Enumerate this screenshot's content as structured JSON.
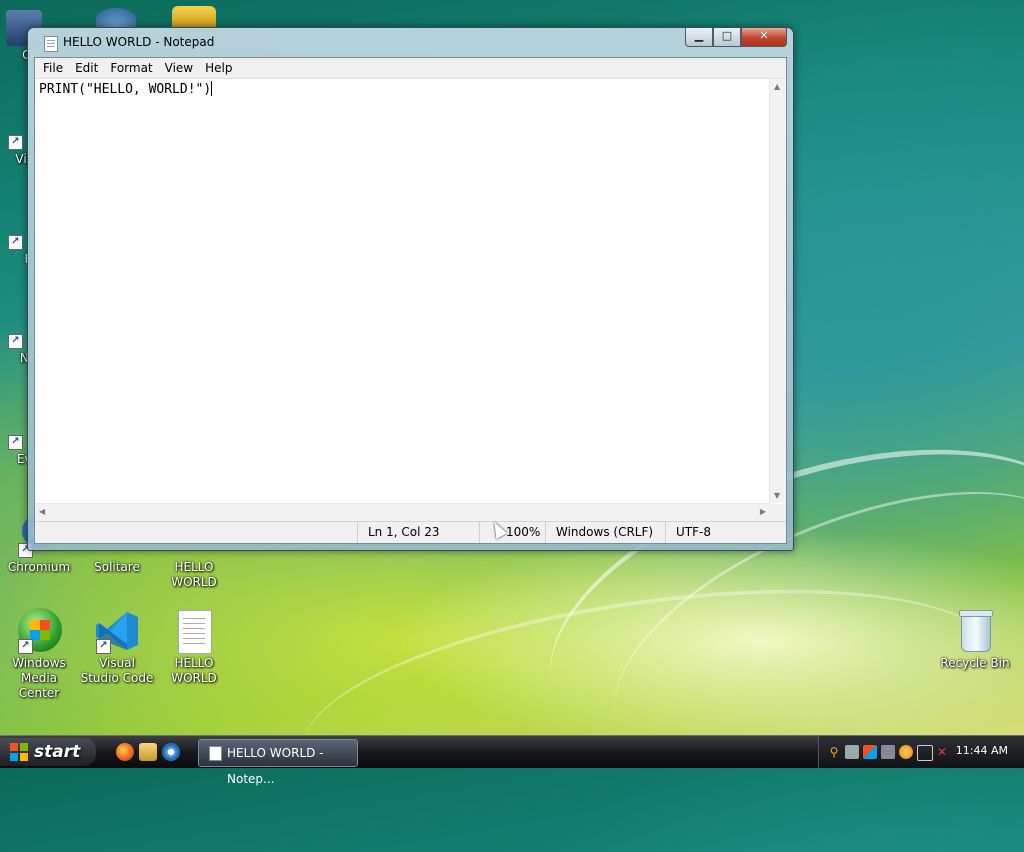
{
  "window": {
    "title": "HELLO WORLD - Notepad",
    "menu": [
      "File",
      "Edit",
      "Format",
      "View",
      "Help"
    ],
    "content": "PRINT(\"HELLO, WORLD!\")",
    "status": {
      "position": "Ln 1, Col 23",
      "zoom": "100%",
      "line_ending": "Windows (CRLF)",
      "encoding": "UTF-8"
    },
    "buttons": {
      "minimize": "▁",
      "maximize": "□",
      "close": "✕"
    }
  },
  "desktop": {
    "partial_labels": [
      "Co",
      "Visu",
      "F",
      "No",
      "Eve"
    ],
    "icons": [
      {
        "label": "Chromium"
      },
      {
        "label": "Solitare"
      },
      {
        "label": "HELLO WORLD"
      },
      {
        "label": "Windows Media Center"
      },
      {
        "label": "Visual Studio Code"
      },
      {
        "label": "HELLO WORLD"
      },
      {
        "label": "Recycle Bin"
      }
    ]
  },
  "taskbar": {
    "start_label": "start",
    "task": "HELLO WORLD - Notep...",
    "clock": "11:44 AM"
  },
  "colors": {
    "title_close": "#c0452c",
    "taskbar": "#18191c",
    "desktop_teal": "#178a7c",
    "desktop_green": "#8ec63a"
  }
}
